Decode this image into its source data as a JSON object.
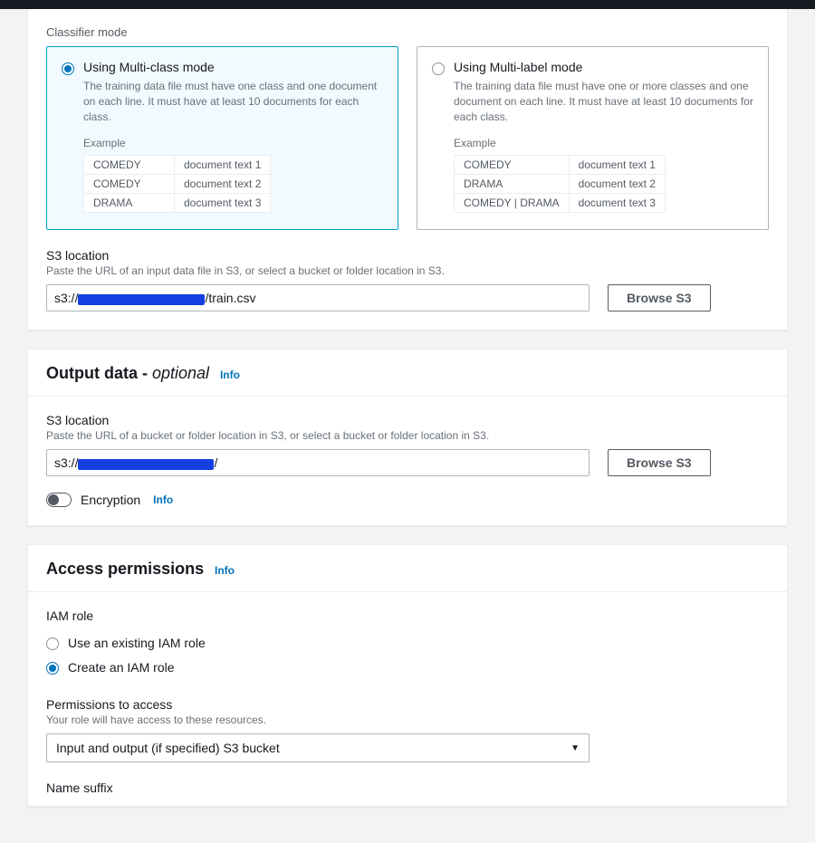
{
  "classifier": {
    "heading": "Classifier mode",
    "multiClass": {
      "title": "Using Multi-class mode",
      "desc": "The training data file must have one class and one document on each line. It must have at least 10 documents for each class.",
      "exampleLabel": "Example",
      "rows": [
        {
          "label": "COMEDY",
          "text": "document text 1"
        },
        {
          "label": "COMEDY",
          "text": "document text 2"
        },
        {
          "label": "DRAMA",
          "text": "document text 3"
        }
      ]
    },
    "multiLabel": {
      "title": "Using Multi-label mode",
      "desc": "The training data file must have one or more classes and one document on each line. It must have at least 10 documents for each class.",
      "exampleLabel": "Example",
      "rows": [
        {
          "label": "COMEDY",
          "text": "document text 1"
        },
        {
          "label": "DRAMA",
          "text": "document text 2"
        },
        {
          "label": "COMEDY | DRAMA",
          "text": "document text 3"
        }
      ]
    },
    "s3": {
      "label": "S3 location",
      "hint": "Paste the URL of an input data file in S3, or select a bucket or folder location in S3.",
      "prefix": "s3://",
      "suffix": "/train.csv",
      "browse": "Browse S3"
    }
  },
  "output": {
    "title": "Output data - ",
    "optional": "optional",
    "info": "Info",
    "s3": {
      "label": "S3 location",
      "hint": "Paste the URL of a bucket or folder location in S3, or select a bucket or folder location in S3.",
      "prefix": "s3://",
      "suffix": "/",
      "browse": "Browse S3"
    },
    "encryption": "Encryption"
  },
  "access": {
    "title": "Access permissions",
    "info": "Info",
    "iamRole": "IAM role",
    "existing": "Use an existing IAM role",
    "create": "Create an IAM role",
    "permLabel": "Permissions to access",
    "permHint": "Your role will have access to these resources.",
    "permValue": "Input and output (if specified) S3 bucket",
    "nameSuffix": "Name suffix"
  }
}
